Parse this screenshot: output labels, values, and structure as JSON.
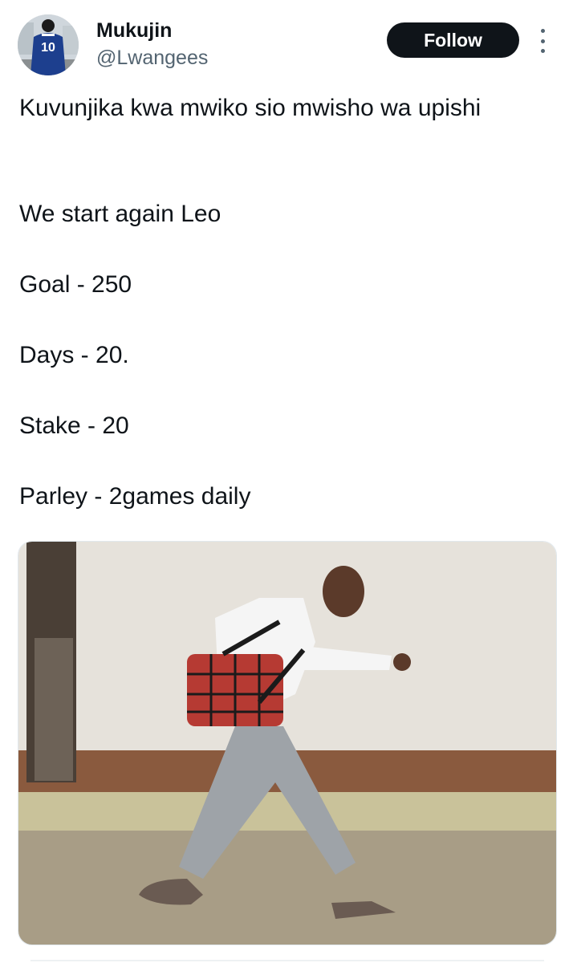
{
  "user": {
    "display_name": "Mukujin",
    "handle": "@Lwangees",
    "avatar_jersey_number": "10"
  },
  "actions": {
    "follow_label": "Follow",
    "more_icon": "more-vertical-icon"
  },
  "tweet": {
    "lines": [
      "Kuvunjika kwa mwiko sio mwisho wa upishi",
      "We start again Leo",
      "Goal - 250",
      "Days - 20.",
      "Stake - 20",
      "Parley - 2games daily"
    ]
  },
  "colors": {
    "text": "#0f1419",
    "secondary_text": "#536471",
    "follow_button_bg": "#0f1419",
    "follow_button_text": "#ffffff"
  }
}
